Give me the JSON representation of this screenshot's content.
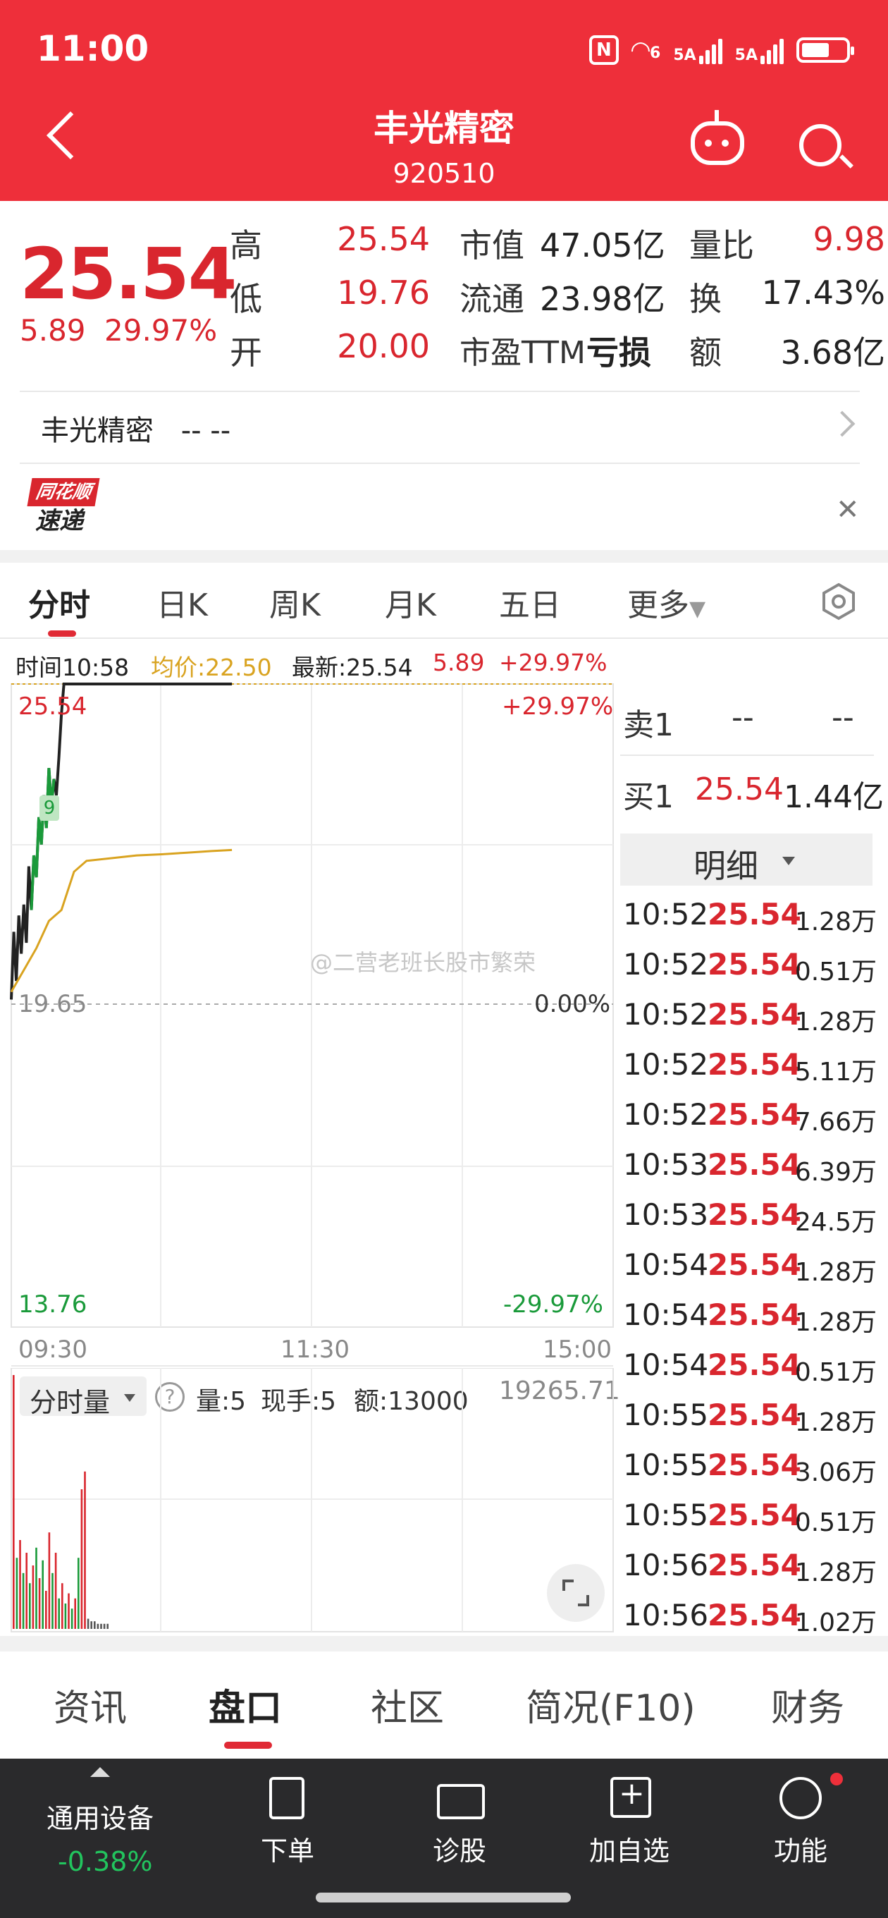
{
  "status_bar": {
    "time": "11:00",
    "net1": "5A",
    "net2": "5A",
    "wifi": "6"
  },
  "header": {
    "title": "丰光精密",
    "code": "920510"
  },
  "quote": {
    "price": "25.54",
    "change": "5.89",
    "change_pct": "29.97%",
    "high_label": "高",
    "high": "25.54",
    "low_label": "低",
    "low": "19.76",
    "open_label": "开",
    "open": "20.00",
    "mktcap_label": "市值",
    "mktcap": "47.05亿",
    "float_label": "流通",
    "float": "23.98亿",
    "pe_label": "市盈TTM",
    "pe": "亏损",
    "vol_ratio_label": "量比",
    "vol_ratio": "9.98",
    "turnover_label": "换",
    "turnover": "17.43%",
    "amount_label": "额",
    "amount": "3.68亿"
  },
  "news_row": {
    "name": "丰光精密",
    "value": "-- --"
  },
  "brand": {
    "top": "同花顺",
    "bottom": "速递"
  },
  "chart_tabs": [
    "分时",
    "日K",
    "周K",
    "月K",
    "五日",
    "更多"
  ],
  "info_line": {
    "time": "时间10:58",
    "avg": "均价:22.50",
    "latest": "最新:25.54",
    "change": "5.89",
    "pct": "+29.97%"
  },
  "chart_labels": {
    "top_price": "25.54",
    "top_pct": "+29.97%",
    "mid_price": "19.65",
    "mid_pct": "0.00%",
    "bot_price": "13.76",
    "bot_pct": "-29.97%",
    "t_start": "09:30",
    "t_mid": "11:30",
    "t_end": "15:00",
    "marker": "9",
    "watermark": "@二营老班长股市繁荣"
  },
  "chart_data": {
    "type": "line",
    "ylim": [
      13.76,
      25.54
    ],
    "xlabel": "",
    "ylabel": "",
    "series": [
      {
        "name": "",
        "color": "#222222",
        "x": [
          "09:30",
          "09:31",
          "09:32",
          "09:33",
          "09:34",
          "09:35",
          "09:36",
          "09:37",
          "09:38",
          "09:39",
          "09:40",
          "09:41",
          "09:42",
          "09:43",
          "09:44",
          "09:45",
          "09:46",
          "09:47",
          "09:48",
          "09:49",
          "09:50",
          "09:51",
          "09:52",
          "09:53",
          "09:54",
          "09:55",
          "09:56",
          "09:57",
          "09:58",
          "09:59",
          "10:00",
          "10:05",
          "10:10",
          "10:20",
          "10:30",
          "10:40",
          "10:50",
          "10:58"
        ],
        "values": [
          19.76,
          21.0,
          20.1,
          21.3,
          20.6,
          21.5,
          20.8,
          22.2,
          21.4,
          22.4,
          22.0,
          23.1,
          22.6,
          23.5,
          22.9,
          24.0,
          23.3,
          23.8,
          23.5,
          24.2,
          25.0,
          25.54,
          25.54,
          25.54,
          25.54,
          25.54,
          25.54,
          25.54,
          25.54,
          25.54,
          25.54,
          25.54,
          25.54,
          25.54,
          25.54,
          25.54,
          25.54,
          25.54
        ]
      },
      {
        "name": "",
        "color": "#d9a320",
        "x": [
          "09:30",
          "09:35",
          "09:40",
          "09:45",
          "09:50",
          "09:55",
          "10:00",
          "10:10",
          "10:20",
          "10:30",
          "10:40",
          "10:50",
          "10:58"
        ],
        "values": [
          19.9,
          20.3,
          20.7,
          21.2,
          21.4,
          22.1,
          22.3,
          22.35,
          22.4,
          22.42,
          22.45,
          22.48,
          22.5
        ]
      }
    ],
    "grid": true
  },
  "order_book": {
    "sell1_label": "卖1",
    "sell1_price": "--",
    "sell1_vol": "--",
    "buy1_label": "买1",
    "buy1_price": "25.54",
    "buy1_vol": "1.44亿",
    "detail_label": "明细"
  },
  "ticks": [
    {
      "t": "10:52",
      "p": "25.54",
      "v": "1.28万"
    },
    {
      "t": "10:52",
      "p": "25.54",
      "v": "0.51万"
    },
    {
      "t": "10:52",
      "p": "25.54",
      "v": "1.28万"
    },
    {
      "t": "10:52",
      "p": "25.54",
      "v": "5.11万"
    },
    {
      "t": "10:52",
      "p": "25.54",
      "v": "7.66万"
    },
    {
      "t": "10:53",
      "p": "25.54",
      "v": "6.39万"
    },
    {
      "t": "10:53",
      "p": "25.54",
      "v": "24.5万"
    },
    {
      "t": "10:54",
      "p": "25.54",
      "v": "1.28万"
    },
    {
      "t": "10:54",
      "p": "25.54",
      "v": "1.28万"
    },
    {
      "t": "10:54",
      "p": "25.54",
      "v": "0.51万"
    },
    {
      "t": "10:55",
      "p": "25.54",
      "v": "1.28万"
    },
    {
      "t": "10:55",
      "p": "25.54",
      "v": "3.06万"
    },
    {
      "t": "10:55",
      "p": "25.54",
      "v": "0.51万"
    },
    {
      "t": "10:56",
      "p": "25.54",
      "v": "1.28万"
    },
    {
      "t": "10:56",
      "p": "25.54",
      "v": "1.02万"
    }
  ],
  "volume": {
    "dropdown": "分时量",
    "help": "?",
    "qty": "量:5",
    "cur": "现手:5",
    "amt": "额:13000",
    "total": "19265.71",
    "bars": [
      {
        "v": 1.0,
        "c": "#d9262e"
      },
      {
        "v": 0.28,
        "c": "#1a9a3a"
      },
      {
        "v": 0.35,
        "c": "#d9262e"
      },
      {
        "v": 0.22,
        "c": "#1a9a3a"
      },
      {
        "v": 0.3,
        "c": "#d9262e"
      },
      {
        "v": 0.18,
        "c": "#1a9a3a"
      },
      {
        "v": 0.25,
        "c": "#d9262e"
      },
      {
        "v": 0.32,
        "c": "#1a9a3a"
      },
      {
        "v": 0.2,
        "c": "#d9262e"
      },
      {
        "v": 0.27,
        "c": "#1a9a3a"
      },
      {
        "v": 0.15,
        "c": "#d9262e"
      },
      {
        "v": 0.38,
        "c": "#d9262e"
      },
      {
        "v": 0.22,
        "c": "#1a9a3a"
      },
      {
        "v": 0.3,
        "c": "#d9262e"
      },
      {
        "v": 0.12,
        "c": "#1a9a3a"
      },
      {
        "v": 0.18,
        "c": "#d9262e"
      },
      {
        "v": 0.1,
        "c": "#1a9a3a"
      },
      {
        "v": 0.14,
        "c": "#d9262e"
      },
      {
        "v": 0.08,
        "c": "#1a9a3a"
      },
      {
        "v": 0.12,
        "c": "#d9262e"
      },
      {
        "v": 0.28,
        "c": "#1a9a3a"
      },
      {
        "v": 0.55,
        "c": "#d9262e"
      },
      {
        "v": 0.62,
        "c": "#d9262e"
      },
      {
        "v": 0.04,
        "c": "#555555"
      },
      {
        "v": 0.03,
        "c": "#555555"
      },
      {
        "v": 0.03,
        "c": "#555555"
      },
      {
        "v": 0.02,
        "c": "#555555"
      },
      {
        "v": 0.02,
        "c": "#555555"
      },
      {
        "v": 0.02,
        "c": "#555555"
      },
      {
        "v": 0.02,
        "c": "#555555"
      }
    ]
  },
  "section_tabs": [
    "资讯",
    "盘口",
    "社区",
    "简况(F10)",
    "财务"
  ],
  "toolbar": {
    "sector_label": "通用设备",
    "sector_pct": "-0.38%",
    "order": "下单",
    "diagnose": "诊股",
    "add_watch": "加自选",
    "function": "功能"
  },
  "colors": {
    "brand_red": "#ee2f3a",
    "up_red": "#d9262e",
    "down_green": "#1a9a3a",
    "avg_gold": "#d9a320"
  }
}
